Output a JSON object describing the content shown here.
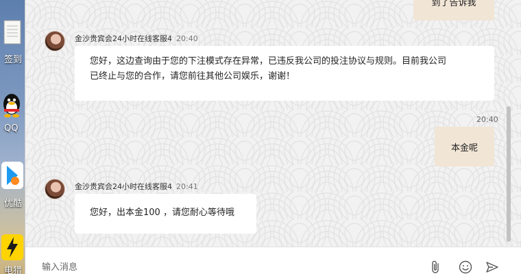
{
  "desktop": {
    "icons": [
      {
        "name": "notepad",
        "label": "签到"
      },
      {
        "name": "qq",
        "label": "QQ"
      },
      {
        "name": "youku",
        "label": "优酷"
      },
      {
        "name": "accelerator",
        "label": "电猎"
      }
    ]
  },
  "chat": {
    "top_bubble_text": "到了告诉我",
    "messages": [
      {
        "direction": "in",
        "sender": "金沙贵宾会24小时在线客服4",
        "time": "20:40",
        "lines": [
          "您好，这边查询由于您的下注模式存在异常，已违反我公司的投注协议与规则。目前我公司",
          "已终止与您的合作，请您前往其他公司娱乐，谢谢！"
        ]
      },
      {
        "direction": "out",
        "time": "20:40",
        "text": "本金呢"
      },
      {
        "direction": "in",
        "sender": "金沙贵宾会24小时在线客服4",
        "time": "20:41",
        "text": "您好，出本金100 ，请您耐心等待哦"
      }
    ]
  },
  "input": {
    "placeholder": "输入消息"
  },
  "toolbar": {
    "icons": [
      "paperclip-icon",
      "emoji-icon",
      "send-icon"
    ]
  },
  "colors": {
    "bubble_out": "#f1e5d6",
    "bubble_in": "#ffffff",
    "background": "#f2f2f2"
  }
}
